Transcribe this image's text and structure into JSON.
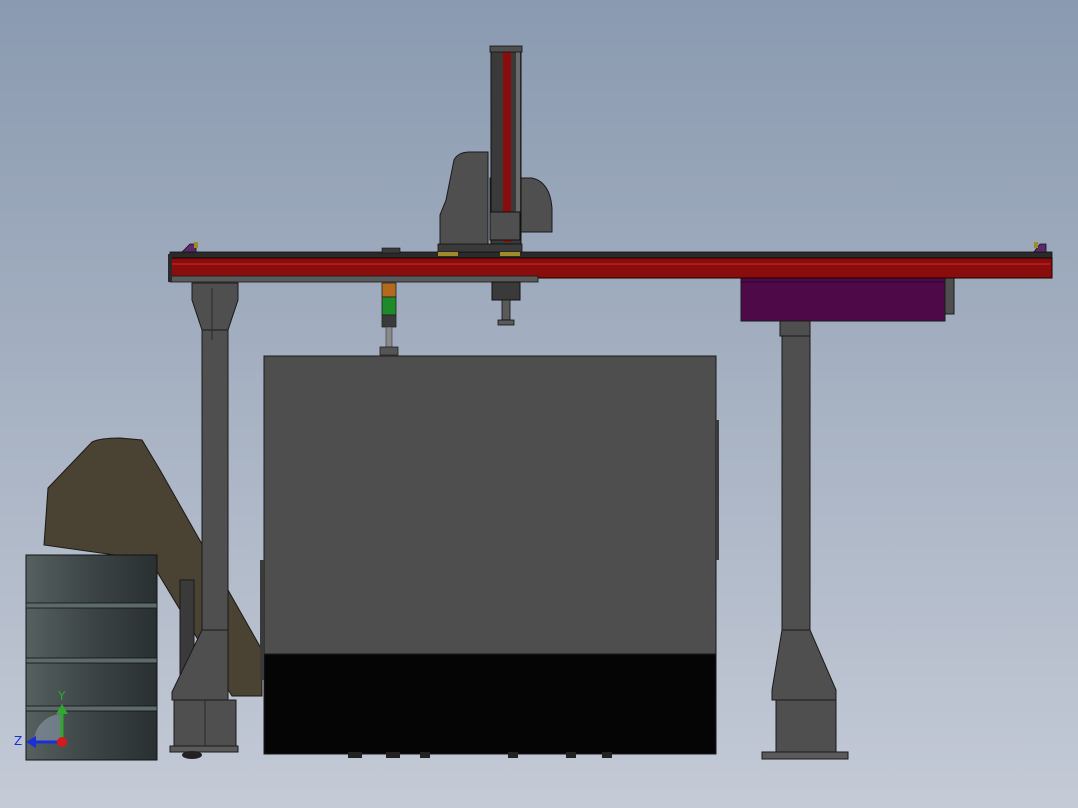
{
  "view": {
    "background_top": "#8a9ab0",
    "background_bottom": "#c4cad6"
  },
  "triad": {
    "y_label": "Y",
    "z_label": "Z",
    "y_color": "#2ea82e",
    "z_color": "#1a2fd6",
    "origin_color": "#d61a1a"
  },
  "colors": {
    "frame": "#4f4f4f",
    "rail_red": "#8a0d0d",
    "rail_dark": "#2a2a2a",
    "cabinet_purple": "#4e0a48",
    "machine_body": "#4e4e4e",
    "machine_base": "#050505",
    "chute": "#4a4232",
    "barrel": "#3c4446",
    "signal_green": "#1f8a2a",
    "signal_orange": "#b46a1e"
  }
}
